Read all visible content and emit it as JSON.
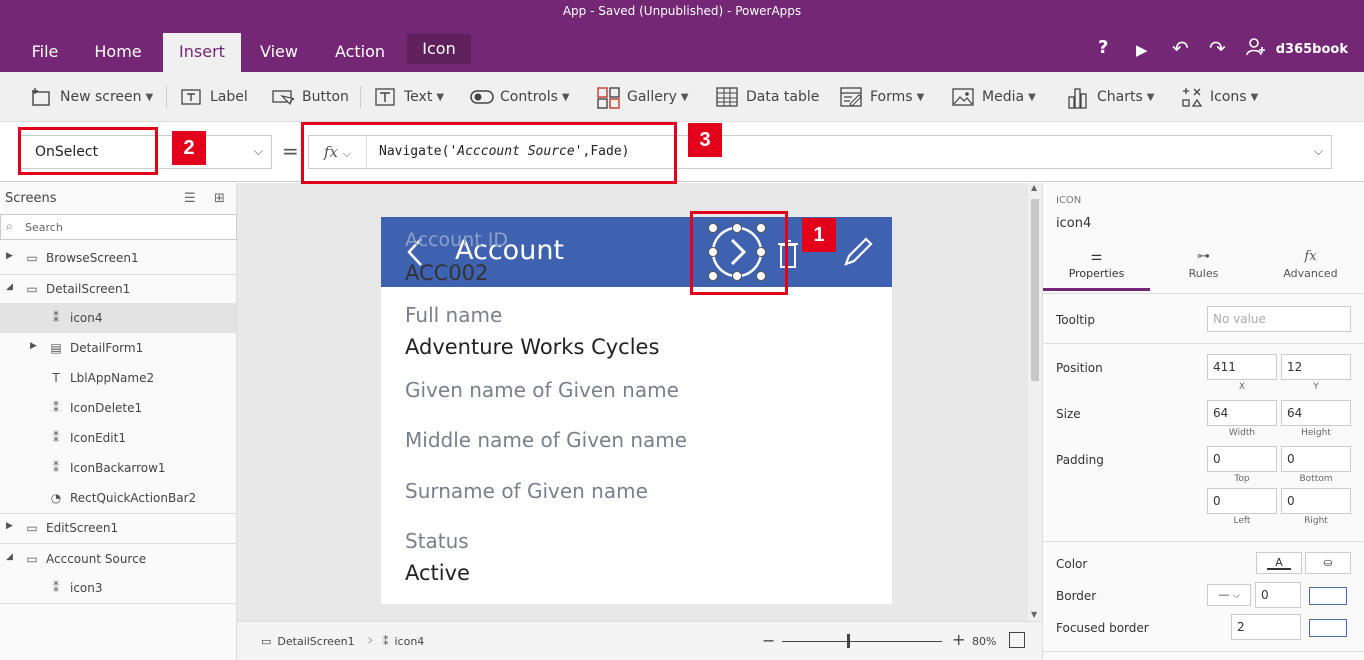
{
  "window": {
    "title": "App - Saved (Unpublished) - PowerApps"
  },
  "menu": {
    "tabs": [
      {
        "label": "File"
      },
      {
        "label": "Home"
      },
      {
        "label": "Insert"
      },
      {
        "label": "View"
      },
      {
        "label": "Action"
      },
      {
        "label": "Icon"
      }
    ],
    "active_tab": "Insert",
    "right": {
      "help": "?",
      "play": "▶",
      "undo": "↶",
      "redo": "↷",
      "user": "d365book"
    }
  },
  "ribbon": {
    "new_screen": "New screen",
    "label": "Label",
    "button": "Button",
    "text": "Text",
    "controls": "Controls",
    "gallery": "Gallery",
    "data_table": "Data table",
    "forms": "Forms",
    "media": "Media",
    "charts": "Charts",
    "icons": "Icons"
  },
  "formula_bar": {
    "property": "OnSelect",
    "equals": "=",
    "fx": "fx",
    "formula_fn": "Navigate(",
    "formula_str": "'Acccount Source'",
    "formula_rest": ",Fade)"
  },
  "callouts": {
    "one": "1",
    "two": "2",
    "three": "3"
  },
  "tree": {
    "header": "Screens",
    "search_placeholder": "Search",
    "items": [
      {
        "label": "BrowseScreen1"
      },
      {
        "label": "DetailScreen1"
      },
      {
        "label": "icon4"
      },
      {
        "label": "DetailForm1"
      },
      {
        "label": "LblAppName2"
      },
      {
        "label": "IconDelete1"
      },
      {
        "label": "IconEdit1"
      },
      {
        "label": "IconBackarrow1"
      },
      {
        "label": "RectQuickActionBar2"
      },
      {
        "label": "EditScreen1"
      },
      {
        "label": "Acccount Source"
      },
      {
        "label": "icon3"
      }
    ]
  },
  "app_screen": {
    "title": "Account",
    "fields": [
      {
        "label": "Account ID",
        "value": "ACC002"
      },
      {
        "label": "Full name",
        "value": "Adventure Works Cycles"
      },
      {
        "label": "Given name of Given name"
      },
      {
        "label": "Middle name of Given name"
      },
      {
        "label": "Surname of Given name"
      },
      {
        "label": "Status",
        "value": "Active"
      }
    ]
  },
  "status_bar": {
    "screen": "DetailScreen1",
    "control": "icon4",
    "zoom": "80%"
  },
  "properties": {
    "kind": "ICON",
    "name": "icon4",
    "tabs": [
      {
        "label": "Properties"
      },
      {
        "label": "Rules"
      },
      {
        "label": "Advanced"
      }
    ],
    "tooltip_label": "Tooltip",
    "tooltip_placeholder": "No value",
    "position_label": "Position",
    "x": "411",
    "y": "12",
    "x_label": "X",
    "y_label": "Y",
    "size_label": "Size",
    "width": "64",
    "height": "64",
    "width_label": "Width",
    "height_label": "Height",
    "padding_label": "Padding",
    "pad_top": "0",
    "pad_bottom": "0",
    "pad_left": "0",
    "pad_right": "0",
    "top_label": "Top",
    "bottom_label": "Bottom",
    "left_label": "Left",
    "right_label": "Right",
    "color_label": "Color",
    "color_text_btn": "A",
    "border_label": "Border",
    "border_width": "0",
    "focused_border_label": "Focused border",
    "focused_border_value": "2"
  }
}
